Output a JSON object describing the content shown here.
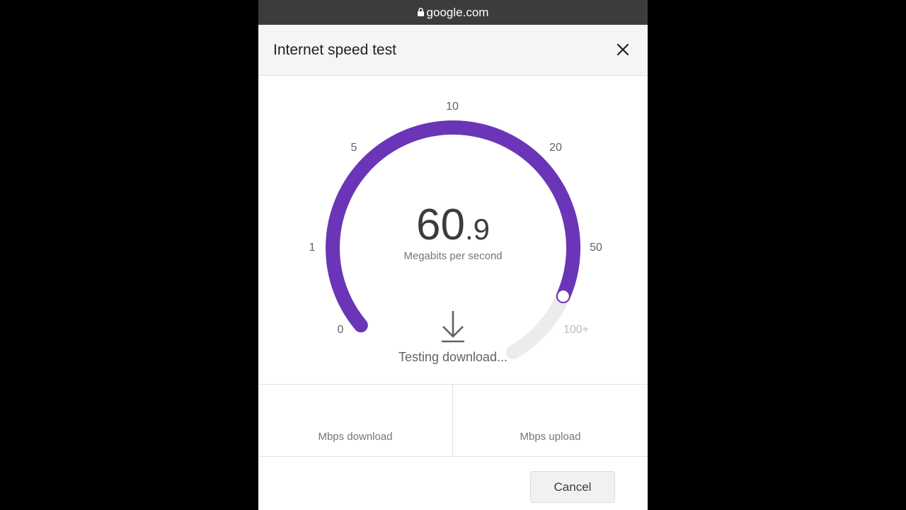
{
  "browser": {
    "url": "google.com",
    "lock_icon": "lock-icon"
  },
  "dialog": {
    "title": "Internet speed test",
    "close_icon": "close-icon"
  },
  "gauge": {
    "ticks": [
      "0",
      "1",
      "5",
      "10",
      "20",
      "50",
      "100+"
    ],
    "value_int": "60",
    "value_dec": ".9",
    "unit": "Megabits per second",
    "fill_fraction": 0.87,
    "colors": {
      "fill": "#6b35b7",
      "track": "#ececec"
    }
  },
  "status": {
    "icon": "download-arrow-icon",
    "text": "Testing download..."
  },
  "results": {
    "download_label": "Mbps download",
    "upload_label": "Mbps upload"
  },
  "actions": {
    "cancel_label": "Cancel"
  }
}
